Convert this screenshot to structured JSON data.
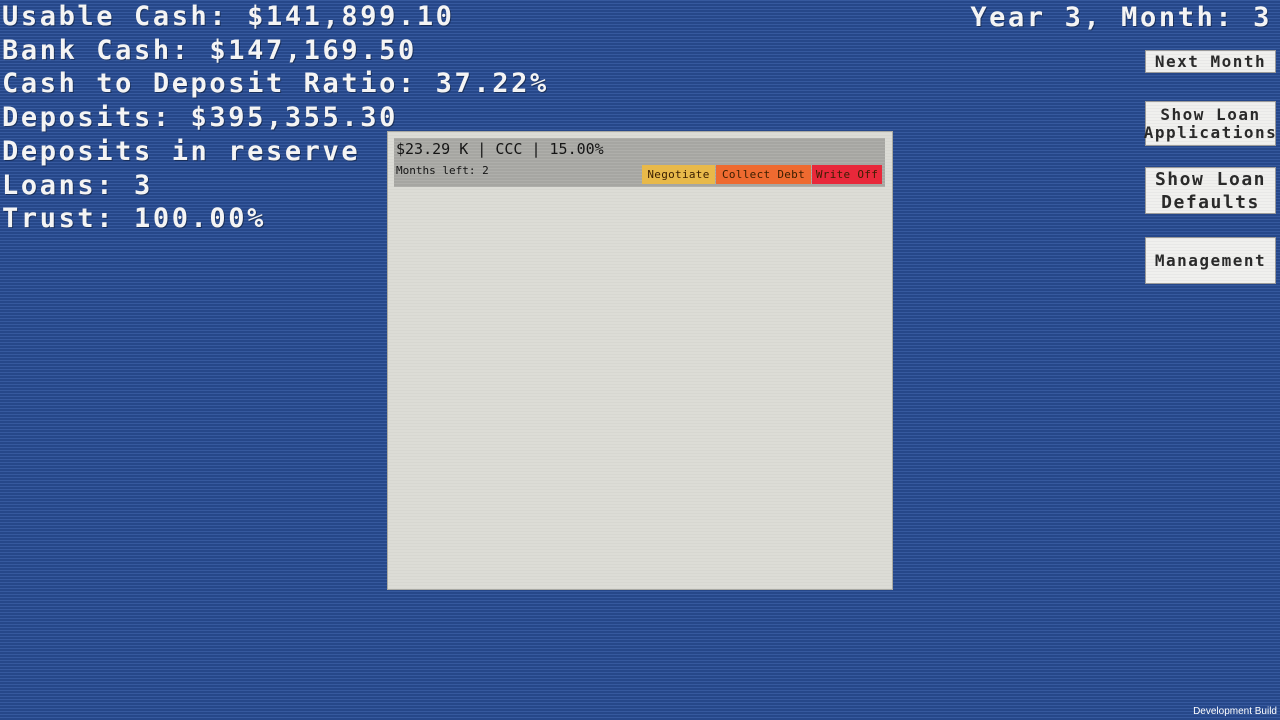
{
  "stats": {
    "usable_cash": "Usable Cash: $141,899.10",
    "bank_cash": "Bank Cash: $147,169.50",
    "ratio": "Cash to Deposit Ratio: 37.22%",
    "deposits": "Deposits: $395,355.30",
    "deposits_reserve": "Deposits in reserve",
    "loans": "Loans: 3",
    "trust": "Trust: 100.00%"
  },
  "date": "Year 3, Month: 3",
  "side_buttons": {
    "next_month": "Next Month",
    "show_applications": "Show Loan Applications",
    "show_defaults": "Show Loan Defaults",
    "management": "Management"
  },
  "loan": {
    "summary": "$23.29 K | CCC | 15.00%",
    "months_left": "Months left: 2",
    "negotiate": "Negotiate",
    "collect": "Collect Debt",
    "write_off": "Write Off"
  },
  "colors": {
    "negotiate": "#e8b94a",
    "collect": "#ee6a30",
    "write_off": "#e8283a"
  },
  "footer": "Development Build"
}
